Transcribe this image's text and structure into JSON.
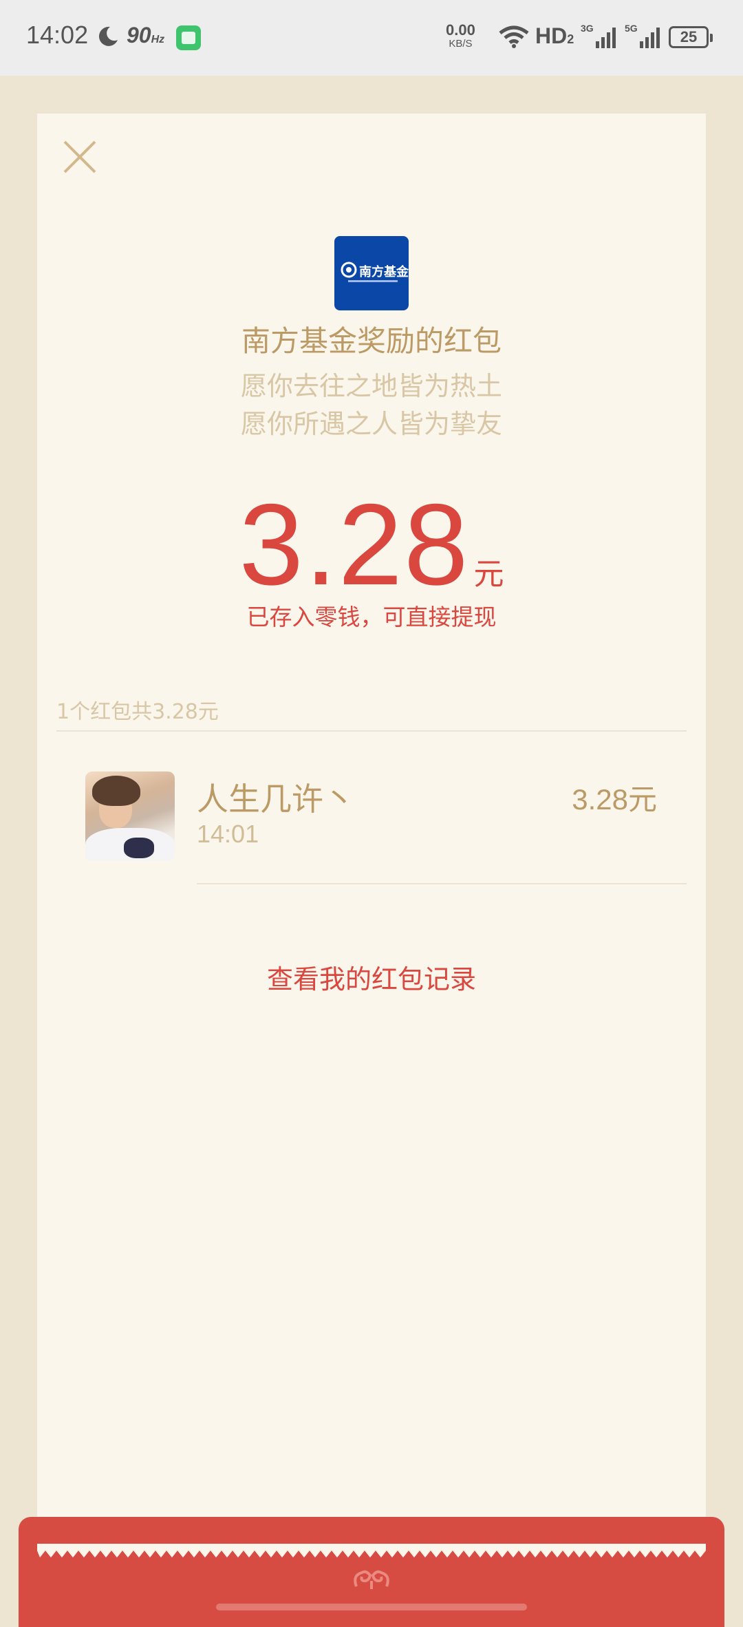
{
  "status_bar": {
    "time": "14:02",
    "refresh_rate": "90",
    "refresh_unit": "Hz",
    "net_speed_value": "0.00",
    "net_speed_unit": "KB/S",
    "hd_label": "HD",
    "hd_sub": "2",
    "sim1_label": "3G",
    "sim2_label": "5G",
    "battery": "25"
  },
  "packet": {
    "sender_logo_text": "南方基金",
    "title": "南方基金奖励的红包",
    "wish_line1": "愿你去往之地皆为热土",
    "wish_line2": "愿你所遇之人皆为挚友",
    "amount": "3.28",
    "amount_unit": "元",
    "deposit_note": "已存入零钱，可直接提现"
  },
  "summary": {
    "text": "1个红包共3.28元"
  },
  "recipients": [
    {
      "name": "人生几许丶",
      "time": "14:01",
      "amount": "3.28元"
    }
  ],
  "links": {
    "view_records": "查看我的红包记录"
  },
  "colors": {
    "accent_red": "#d9473f",
    "gold": "#bb9a66",
    "card_bg": "#faf6ec",
    "page_bg": "#ede4d2"
  }
}
